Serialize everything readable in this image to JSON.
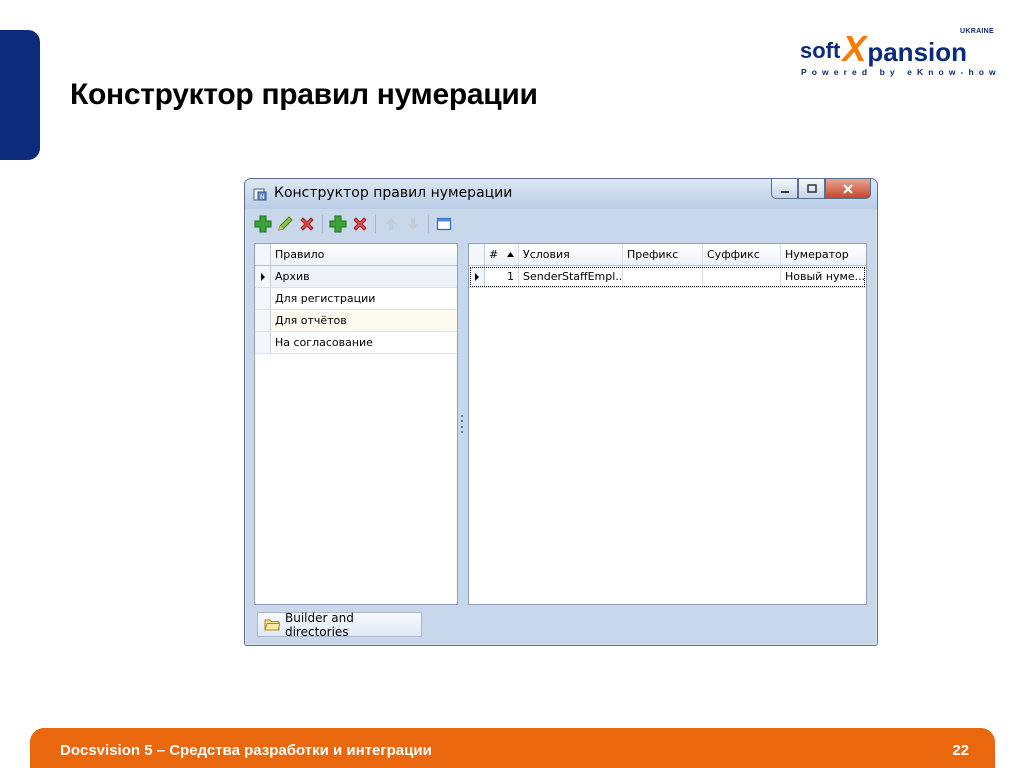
{
  "slide": {
    "title": "Конструктор правил нумерации",
    "footer_text": "Docsvision 5 – Средства разработки и интеграции",
    "page_number": "22"
  },
  "logo": {
    "soft": "soft",
    "x": "X",
    "pansion": "pansion",
    "country": "UKRAINE",
    "tagline": "Powered by eKnow-how"
  },
  "window": {
    "title": "Конструктор правил нумерации",
    "toolbar": [
      {
        "icon": "add-icon",
        "enabled": true
      },
      {
        "icon": "edit-icon",
        "enabled": true
      },
      {
        "icon": "delete-icon",
        "enabled": true
      },
      {
        "icon": "add-icon",
        "enabled": true
      },
      {
        "icon": "delete-icon",
        "enabled": true
      },
      {
        "icon": "arrow-up-icon",
        "enabled": false
      },
      {
        "icon": "arrow-down-icon",
        "enabled": false
      },
      {
        "icon": "window-icon",
        "enabled": true
      }
    ],
    "rules_grid": {
      "header": "Правило",
      "rows": [
        "Архив",
        "Для регистрации",
        "Для отчётов",
        "На согласование"
      ],
      "selected_index": 0
    },
    "conditions_grid": {
      "columns": [
        "#",
        "Условия",
        "Префикс",
        "Суффикс",
        "Нумератор"
      ],
      "sort_column": "#",
      "rows": [
        {
          "num": "1",
          "condition": "SenderStaffEmpl...",
          "prefix": "",
          "suffix": "",
          "numerator": "Новый нуме..."
        }
      ]
    },
    "status_tab": "Builder and directories"
  },
  "colors": {
    "brand_blue": "#0c2b7a",
    "brand_orange": "#e9680e"
  }
}
